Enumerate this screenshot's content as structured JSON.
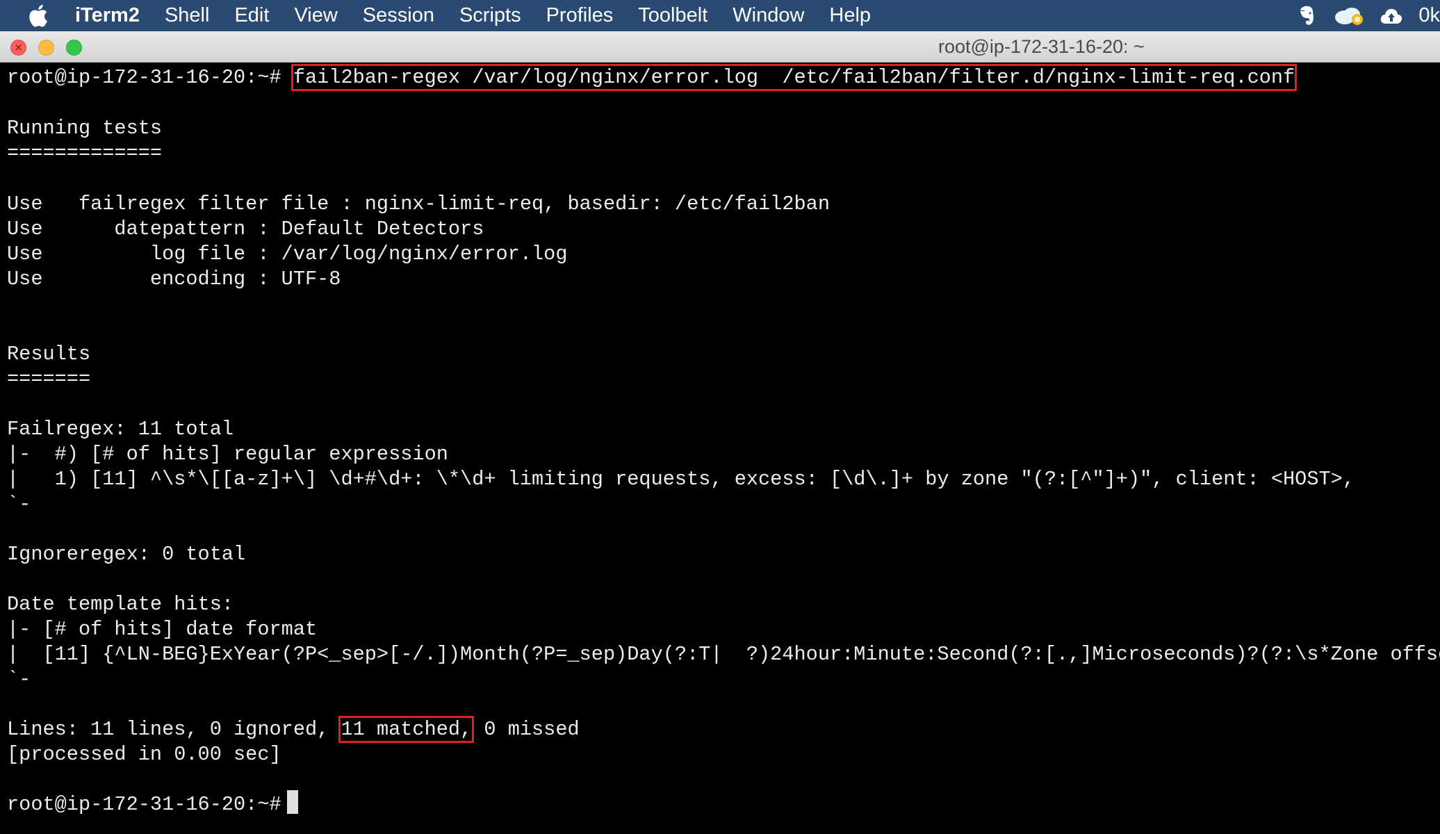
{
  "menubar": {
    "app_name": "iTerm2",
    "items": [
      "Shell",
      "Edit",
      "View",
      "Session",
      "Scripts",
      "Profiles",
      "Toolbelt",
      "Window",
      "Help"
    ],
    "tray_text": "0k",
    "icons": [
      "apple-icon",
      "evernote-icon",
      "cloud-weather-icon",
      "cloud-upload-icon"
    ]
  },
  "window": {
    "title": "root@ip-172-31-16-20: ~"
  },
  "terminal": {
    "prompt": "root@ip-172-31-16-20:~#",
    "command": "fail2ban-regex /var/log/nginx/error.log  /etc/fail2ban/filter.d/nginx-limit-req.conf",
    "running_tests": "Running tests",
    "running_rule": "=============",
    "use_lines": [
      "Use   failregex filter file : nginx-limit-req, basedir: /etc/fail2ban",
      "Use      datepattern : Default Detectors",
      "Use         log file : /var/log/nginx/error.log",
      "Use         encoding : UTF-8"
    ],
    "results": "Results",
    "results_rule": "=======",
    "failregex_total": "Failregex: 11 total",
    "failregex_header": "|-  #) [# of hits] regular expression",
    "failregex_row": "|   1) [11] ^\\s*\\[[a-z]+\\] \\d+#\\d+: \\*\\d+ limiting requests, excess: [\\d\\.]+ by zone \"(?:[^\"]+)\", client: <HOST>,",
    "failregex_end": "`-",
    "ignoreregex_total": "Ignoreregex: 0 total",
    "date_template_hits": "Date template hits:",
    "date_header": "|- [# of hits] date format",
    "date_row": "|  [11] {^LN-BEG}ExYear(?P<_sep>[-/.])Month(?P=_sep)Day(?:T|  ?)24hour:Minute:Second(?:[.,]Microseconds)?(?:\\s*Zone offset)?",
    "date_end": "`-",
    "lines_prefix": "Lines: 11 lines, 0 ignored,",
    "lines_matched": "11 matched,",
    "lines_suffix": "0 missed",
    "processed": "[processed in 0.00 sec]",
    "final_prompt": "root@ip-172-31-16-20:~#"
  },
  "colors": {
    "menubar_bg": "#2b4a72",
    "terminal_bg": "#000000",
    "terminal_fg": "#ececec",
    "highlight_box": "#e02020"
  }
}
